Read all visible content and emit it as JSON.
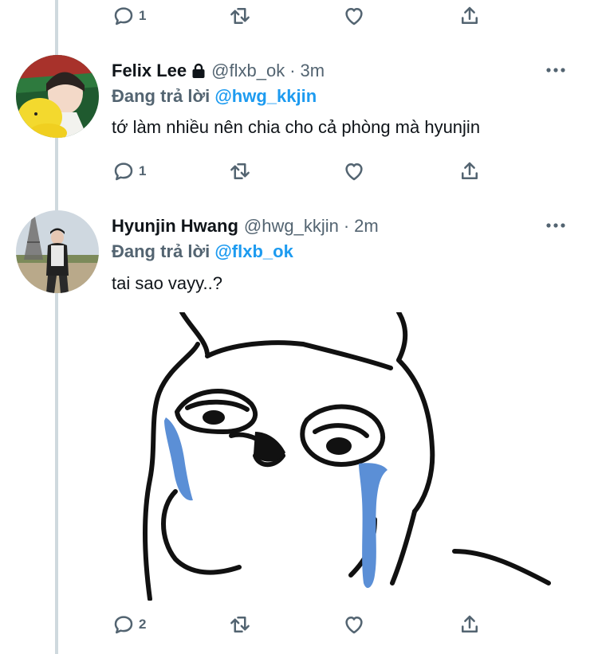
{
  "top_actions": {
    "reply_count": "1"
  },
  "tweets": [
    {
      "display_name": "Felix Lee",
      "handle": "@flxb_ok",
      "sep": "·",
      "time": "3m",
      "locked": true,
      "replying_prefix": "Đang trả lời",
      "replying_to": "@hwg_kkjin",
      "text": "tớ làm nhiều nên chia cho cả phòng mà hyunjin",
      "reply_count": "1"
    },
    {
      "display_name": "Hyunjin Hwang",
      "handle": "@hwg_kkjin",
      "sep": "·",
      "time": "2m",
      "locked": false,
      "replying_prefix": "Đang trả lời",
      "replying_to": "@flxb_ok",
      "text": "tai sao vayy..?",
      "reply_count": "2"
    }
  ],
  "icons": {
    "reply": "comment-bubble-icon",
    "retweet": "retweet-arrows-icon",
    "like": "heart-icon",
    "share": "share-upload-icon",
    "more": "more-dots-icon",
    "lock": "lock-icon"
  },
  "colors": {
    "link": "#1d9bf0",
    "secondary": "#536471",
    "thread_line": "#cfd9de",
    "tear_blue": "#5b8fd6"
  }
}
